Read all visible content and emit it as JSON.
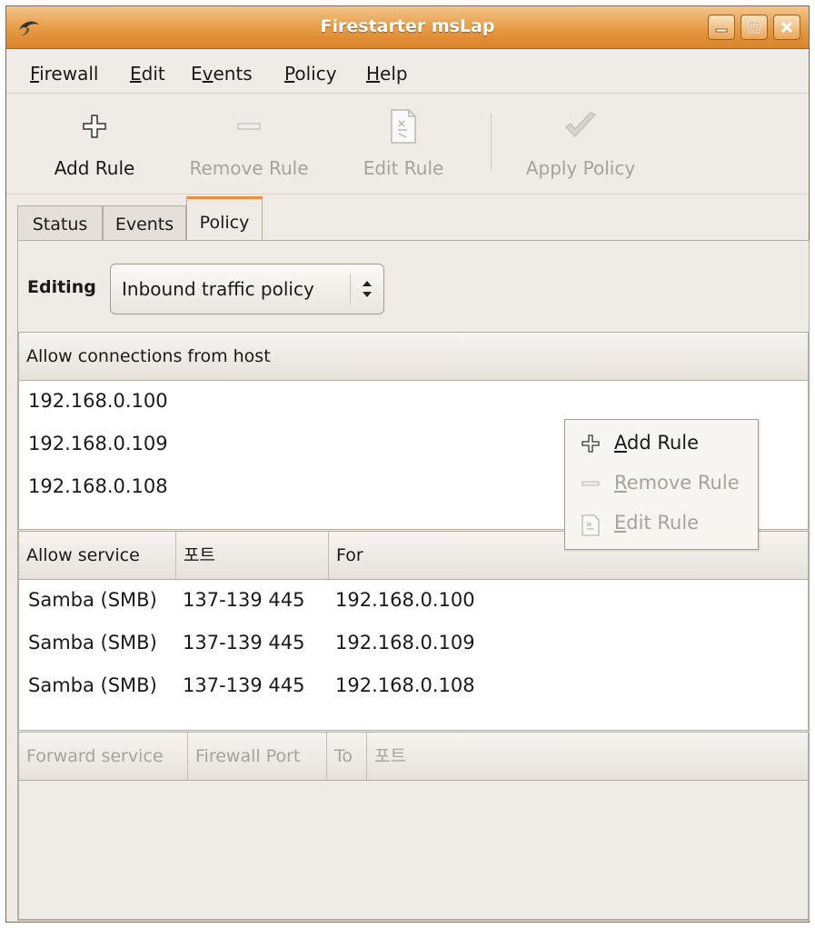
{
  "window": {
    "title": "Firestarter msLap",
    "controls": [
      "minimize-icon",
      "maximize-icon",
      "close-icon"
    ],
    "accent": "#e69a42"
  },
  "menubar": {
    "items": [
      {
        "label": "Firewall",
        "mnemonic": "F"
      },
      {
        "label": "Edit",
        "mnemonic": "E"
      },
      {
        "label": "Events",
        "mnemonic": "v"
      },
      {
        "label": "Policy",
        "mnemonic": "P"
      },
      {
        "label": "Help",
        "mnemonic": "H"
      }
    ]
  },
  "toolbar": {
    "add_rule": {
      "label": "Add Rule",
      "icon": "add-icon",
      "enabled": true
    },
    "remove_rule": {
      "label": "Remove Rule",
      "icon": "remove-icon",
      "enabled": false
    },
    "edit_rule": {
      "label": "Edit Rule",
      "icon": "edit-document-icon",
      "enabled": false
    },
    "apply_policy": {
      "label": "Apply Policy",
      "icon": "checkmark-icon",
      "enabled": false
    }
  },
  "tabs": [
    {
      "label": "Status",
      "active": false
    },
    {
      "label": "Events",
      "active": false
    },
    {
      "label": "Policy",
      "active": true
    }
  ],
  "policy": {
    "editing_label": "Editing",
    "editing_value": "Inbound traffic policy",
    "hosts": {
      "header": "Allow connections from host",
      "rows": [
        "192.168.0.100",
        "192.168.0.109",
        "192.168.0.108"
      ]
    },
    "services": {
      "headers": [
        "Allow service",
        "포트",
        "For"
      ],
      "rows": [
        [
          "Samba (SMB)",
          "137-139 445",
          "192.168.0.100"
        ],
        [
          "Samba (SMB)",
          "137-139 445",
          "192.168.0.109"
        ],
        [
          "Samba (SMB)",
          "137-139 445",
          "192.168.0.108"
        ]
      ]
    },
    "forward": {
      "headers": [
        "Forward service",
        "Firewall Port",
        "To",
        "포트"
      ],
      "rows": []
    }
  },
  "context_menu": {
    "items": [
      {
        "label": "Add Rule",
        "mnemonic": "A",
        "icon": "add-icon",
        "enabled": true
      },
      {
        "label": "Remove Rule",
        "mnemonic": "R",
        "icon": "remove-icon",
        "enabled": false
      },
      {
        "label": "Edit Rule",
        "mnemonic": "E",
        "icon": "edit-document-icon",
        "enabled": false
      }
    ]
  }
}
